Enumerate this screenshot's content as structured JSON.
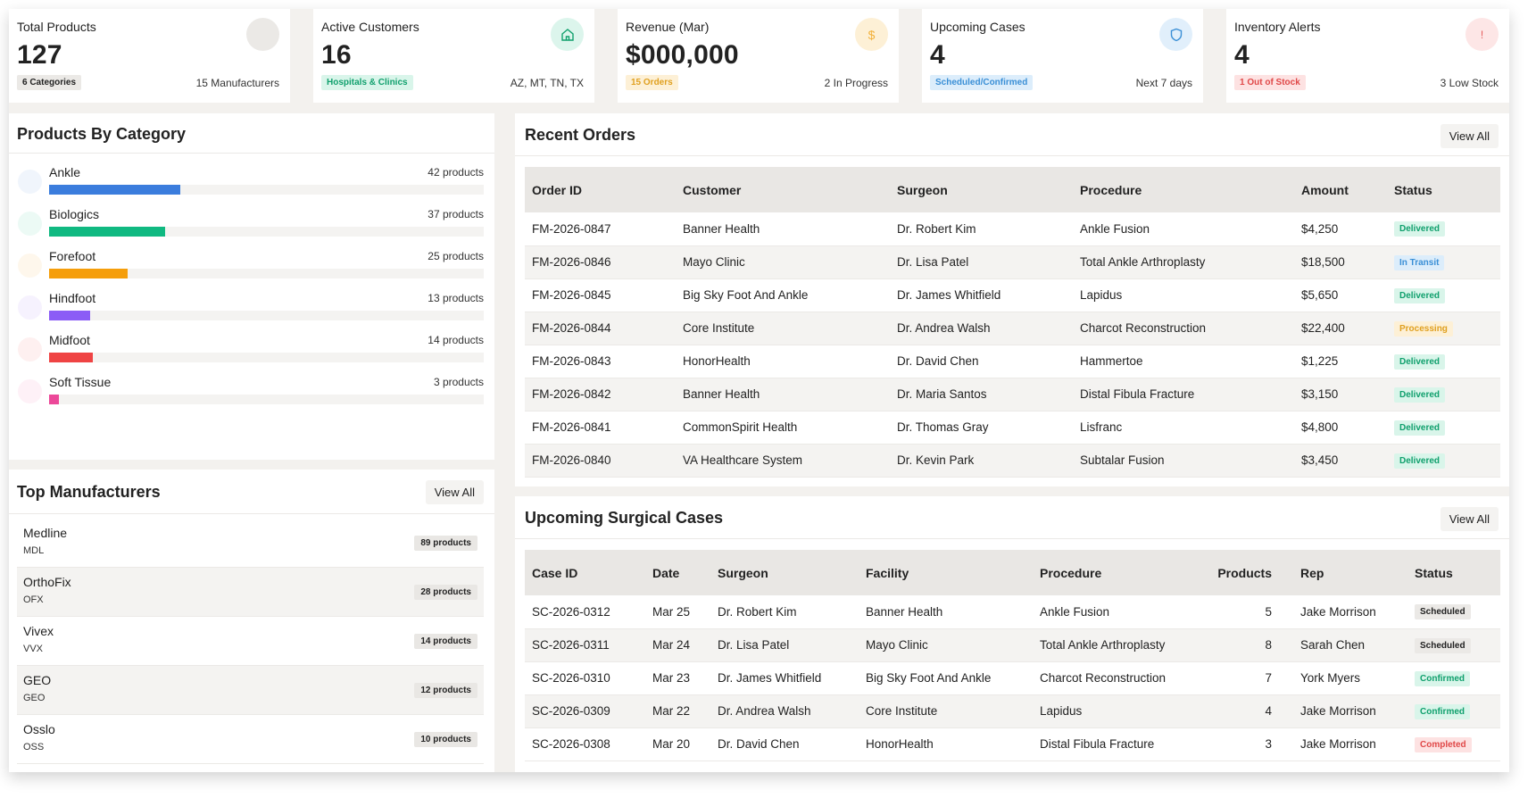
{
  "colors": {
    "blue": "#3b7ddd",
    "green": "#10b981",
    "orange": "#f59e0b",
    "purple": "#8b5cf6",
    "red": "#ef4444",
    "pink": "#ec4899"
  },
  "stats": [
    {
      "title": "Total Products",
      "value": "127",
      "badge": "6 Categories",
      "note": "15 Manufacturers",
      "icon": "circle-icon"
    },
    {
      "title": "Active Customers",
      "value": "16",
      "badge": "Hospitals & Clinics",
      "note": "AZ, MT, TN, TX",
      "icon": "hospital-icon"
    },
    {
      "title": "Revenue (Mar)",
      "value": "$000,000",
      "badge": "15 Orders",
      "note": "2 In Progress",
      "icon": "dollar-icon",
      "icon_text": "$"
    },
    {
      "title": "Upcoming Cases",
      "value": "4",
      "badge": "Scheduled/Confirmed",
      "note": "Next 7 days",
      "icon": "shield-icon"
    },
    {
      "title": "Inventory Alerts",
      "value": "4",
      "badge": "1 Out of Stock",
      "note": "3 Low Stock",
      "icon": "alert-icon",
      "icon_text": "!"
    }
  ],
  "categories": {
    "title": "Products By Category",
    "max": 42,
    "items": [
      {
        "name": "Ankle",
        "count": 42,
        "count_label": "42 products",
        "color": "#3b7ddd"
      },
      {
        "name": "Biologics",
        "count": 37,
        "count_label": "37 products",
        "color": "#10b981"
      },
      {
        "name": "Forefoot",
        "count": 25,
        "count_label": "25 products",
        "color": "#f59e0b"
      },
      {
        "name": "Hindfoot",
        "count": 13,
        "count_label": "13 products",
        "color": "#8b5cf6"
      },
      {
        "name": "Midfoot",
        "count": 14,
        "count_label": "14 products",
        "color": "#ef4444"
      },
      {
        "name": "Soft Tissue",
        "count": 3,
        "count_label": "3 products",
        "color": "#ec4899"
      }
    ]
  },
  "manufacturers": {
    "title": "Top Manufacturers",
    "view_all": "View All",
    "items": [
      {
        "name": "Medline",
        "code": "MDL",
        "count": "89 products"
      },
      {
        "name": "OrthoFix",
        "code": "OFX",
        "count": "28 products"
      },
      {
        "name": "Vivex",
        "code": "VVX",
        "count": "14 products"
      },
      {
        "name": "GEO",
        "code": "GEO",
        "count": "12 products"
      },
      {
        "name": "Osslo",
        "code": "OSS",
        "count": "10 products"
      }
    ]
  },
  "orders": {
    "title": "Recent Orders",
    "view_all": "View All",
    "columns": [
      "Order ID",
      "Customer",
      "Surgeon",
      "Procedure",
      "Amount",
      "Status"
    ],
    "rows": [
      {
        "id": "FM-2026-0847",
        "customer": "Banner Health",
        "surgeon": "Dr. Robert Kim",
        "procedure": "Ankle Fusion",
        "amount": "$4,250",
        "status": "Delivered"
      },
      {
        "id": "FM-2026-0846",
        "customer": "Mayo Clinic",
        "surgeon": "Dr. Lisa Patel",
        "procedure": "Total Ankle Arthroplasty",
        "amount": "$18,500",
        "status": "In Transit"
      },
      {
        "id": "FM-2026-0845",
        "customer": "Big Sky Foot And Ankle",
        "surgeon": "Dr. James Whitfield",
        "procedure": "Lapidus",
        "amount": "$5,650",
        "status": "Delivered"
      },
      {
        "id": "FM-2026-0844",
        "customer": "Core Institute",
        "surgeon": "Dr. Andrea Walsh",
        "procedure": "Charcot Reconstruction",
        "amount": "$22,400",
        "status": "Processing"
      },
      {
        "id": "FM-2026-0843",
        "customer": "HonorHealth",
        "surgeon": "Dr. David Chen",
        "procedure": "Hammertoe",
        "amount": "$1,225",
        "status": "Delivered"
      },
      {
        "id": "FM-2026-0842",
        "customer": "Banner Health",
        "surgeon": "Dr. Maria Santos",
        "procedure": "Distal Fibula Fracture",
        "amount": "$3,150",
        "status": "Delivered"
      },
      {
        "id": "FM-2026-0841",
        "customer": "CommonSpirit Health",
        "surgeon": "Dr. Thomas Gray",
        "procedure": "Lisfranc",
        "amount": "$4,800",
        "status": "Delivered"
      },
      {
        "id": "FM-2026-0840",
        "customer": "VA Healthcare System",
        "surgeon": "Dr. Kevin Park",
        "procedure": "Subtalar Fusion",
        "amount": "$3,450",
        "status": "Delivered"
      }
    ]
  },
  "cases": {
    "title": "Upcoming Surgical Cases",
    "view_all": "View All",
    "columns": [
      "Case ID",
      "Date",
      "Surgeon",
      "Facility",
      "Procedure",
      "Products",
      "Rep",
      "Status"
    ],
    "rows": [
      {
        "id": "SC-2026-0312",
        "date": "Mar 25",
        "surgeon": "Dr. Robert Kim",
        "facility": "Banner Health",
        "procedure": "Ankle Fusion",
        "products": "5",
        "rep": "Jake Morrison",
        "status": "Scheduled"
      },
      {
        "id": "SC-2026-0311",
        "date": "Mar 24",
        "surgeon": "Dr. Lisa Patel",
        "facility": "Mayo Clinic",
        "procedure": "Total Ankle Arthroplasty",
        "products": "8",
        "rep": "Sarah Chen",
        "status": "Scheduled"
      },
      {
        "id": "SC-2026-0310",
        "date": "Mar 23",
        "surgeon": "Dr. James Whitfield",
        "facility": "Big Sky Foot And Ankle",
        "procedure": "Charcot Reconstruction",
        "products": "7",
        "rep": "York Myers",
        "status": "Confirmed"
      },
      {
        "id": "SC-2026-0309",
        "date": "Mar 22",
        "surgeon": "Dr. Andrea Walsh",
        "facility": "Core Institute",
        "procedure": "Lapidus",
        "products": "4",
        "rep": "Jake Morrison",
        "status": "Confirmed"
      },
      {
        "id": "SC-2026-0308",
        "date": "Mar 20",
        "surgeon": "Dr. David Chen",
        "facility": "HonorHealth",
        "procedure": "Distal Fibula Fracture",
        "products": "3",
        "rep": "Jake Morrison",
        "status": "Completed"
      }
    ]
  }
}
